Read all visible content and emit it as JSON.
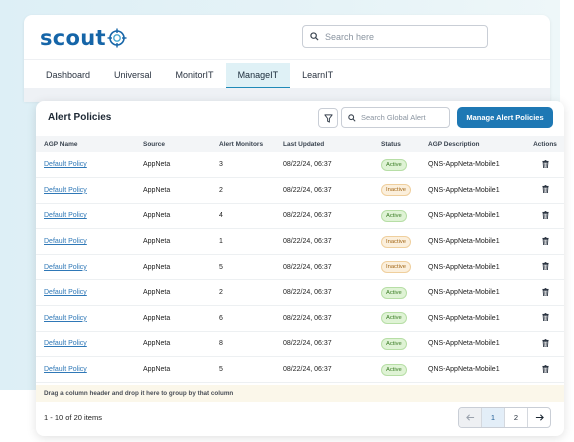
{
  "app": {
    "logo": "scout",
    "search_placeholder": "Search here"
  },
  "nav": {
    "tabs": [
      "Dashboard",
      "Universal",
      "MonitorIT",
      "ManageIT",
      "LearnIT"
    ],
    "active": "ManageIT"
  },
  "panel": {
    "title": "Alert Policies",
    "search_placeholder": "Search Global Alert",
    "manage_button": "Manage Alert Policies"
  },
  "table": {
    "headers": [
      "AGP Name",
      "Source",
      "Alert Monitors",
      "Last Updated",
      "Status",
      "AGP Description",
      "Actions"
    ],
    "rows": [
      {
        "name": "Default Policy",
        "source": "AppNeta",
        "monitors": "3",
        "updated": "08/22/24, 06:37",
        "status": "Active",
        "description": "QNS-AppNeta-Mobile1"
      },
      {
        "name": "Default Policy",
        "source": "AppNeta",
        "monitors": "2",
        "updated": "08/22/24, 06:37",
        "status": "Inactive",
        "description": "QNS-AppNeta-Mobile1"
      },
      {
        "name": "Default Policy",
        "source": "AppNeta",
        "monitors": "4",
        "updated": "08/22/24, 06:37",
        "status": "Active",
        "description": "QNS-AppNeta-Mobile1"
      },
      {
        "name": "Default Policy",
        "source": "AppNeta",
        "monitors": "1",
        "updated": "08/22/24, 06:37",
        "status": "Inactive",
        "description": "QNS-AppNeta-Mobile1"
      },
      {
        "name": "Default Policy",
        "source": "AppNeta",
        "monitors": "5",
        "updated": "08/22/24, 06:37",
        "status": "Inactive",
        "description": "QNS-AppNeta-Mobile1"
      },
      {
        "name": "Default Policy",
        "source": "AppNeta",
        "monitors": "2",
        "updated": "08/22/24, 06:37",
        "status": "Active",
        "description": "QNS-AppNeta-Mobile1"
      },
      {
        "name": "Default Policy",
        "source": "AppNeta",
        "monitors": "6",
        "updated": "08/22/24, 06:37",
        "status": "Active",
        "description": "QNS-AppNeta-Mobile1"
      },
      {
        "name": "Default Policy",
        "source": "AppNeta",
        "monitors": "8",
        "updated": "08/22/24, 06:37",
        "status": "Active",
        "description": "QNS-AppNeta-Mobile1"
      },
      {
        "name": "Default Policy",
        "source": "AppNeta",
        "monitors": "5",
        "updated": "08/22/24, 06:37",
        "status": "Active",
        "description": "QNS-AppNeta-Mobile1"
      }
    ],
    "action_icon": "trash-icon",
    "group_hint": "Drag a column header and drop it here to group by that column"
  },
  "footer": {
    "count": "1 - 10 of 20 items",
    "pages": [
      "1",
      "2"
    ],
    "current_page": "1"
  },
  "colors": {
    "brand": "#1565a8",
    "primary_button": "#1e78b4",
    "active_badge": "#dff3d5",
    "inactive_badge": "#fbefdc"
  }
}
